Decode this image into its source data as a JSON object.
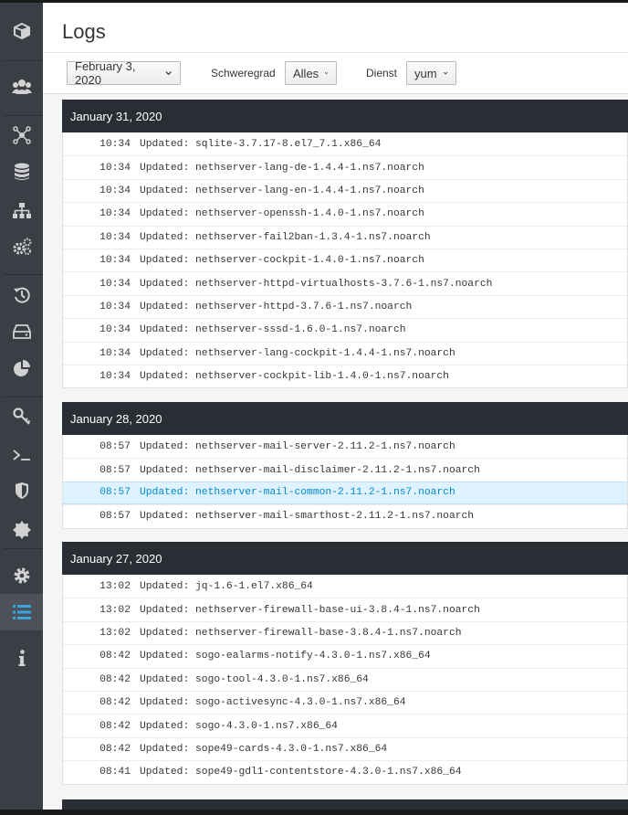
{
  "page": {
    "title": "Logs"
  },
  "filters": {
    "date_value": "February 3, 2020",
    "severity_label": "Schweregrad",
    "severity_value": "Alles",
    "service_label": "Dienst",
    "service_value": "yum"
  },
  "groups": [
    {
      "date": "January 31, 2020",
      "rows": [
        {
          "time": "10:34",
          "msg": "Updated: sqlite-3.7.17-8.el7_7.1.x86_64"
        },
        {
          "time": "10:34",
          "msg": "Updated: nethserver-lang-de-1.4.4-1.ns7.noarch"
        },
        {
          "time": "10:34",
          "msg": "Updated: nethserver-lang-en-1.4.4-1.ns7.noarch"
        },
        {
          "time": "10:34",
          "msg": "Updated: nethserver-openssh-1.4.0-1.ns7.noarch"
        },
        {
          "time": "10:34",
          "msg": "Updated: nethserver-fail2ban-1.3.4-1.ns7.noarch"
        },
        {
          "time": "10:34",
          "msg": "Updated: nethserver-cockpit-1.4.0-1.ns7.noarch"
        },
        {
          "time": "10:34",
          "msg": "Updated: nethserver-httpd-virtualhosts-3.7.6-1.ns7.noarch"
        },
        {
          "time": "10:34",
          "msg": "Updated: nethserver-httpd-3.7.6-1.ns7.noarch"
        },
        {
          "time": "10:34",
          "msg": "Updated: nethserver-sssd-1.6.0-1.ns7.noarch"
        },
        {
          "time": "10:34",
          "msg": "Updated: nethserver-lang-cockpit-1.4.4-1.ns7.noarch"
        },
        {
          "time": "10:34",
          "msg": "Updated: nethserver-cockpit-lib-1.4.0-1.ns7.noarch"
        }
      ]
    },
    {
      "date": "January 28, 2020",
      "rows": [
        {
          "time": "08:57",
          "msg": "Updated: nethserver-mail-server-2.11.2-1.ns7.noarch"
        },
        {
          "time": "08:57",
          "msg": "Updated: nethserver-mail-disclaimer-2.11.2-1.ns7.noarch"
        },
        {
          "time": "08:57",
          "msg": "Updated: nethserver-mail-common-2.11.2-1.ns7.noarch"
        },
        {
          "time": "08:57",
          "msg": "Updated: nethserver-mail-smarthost-2.11.2-1.ns7.noarch"
        }
      ]
    },
    {
      "date": "January 27, 2020",
      "rows": [
        {
          "time": "13:02",
          "msg": "Updated: jq-1.6-1.el7.x86_64"
        },
        {
          "time": "13:02",
          "msg": "Updated: nethserver-firewall-base-ui-3.8.4-1.ns7.noarch"
        },
        {
          "time": "13:02",
          "msg": "Updated: nethserver-firewall-base-3.8.4-1.ns7.noarch"
        },
        {
          "time": "08:42",
          "msg": "Updated: sogo-ealarms-notify-4.3.0-1.ns7.x86_64"
        },
        {
          "time": "08:42",
          "msg": "Updated: sogo-tool-4.3.0-1.ns7.x86_64"
        },
        {
          "time": "08:42",
          "msg": "Updated: sogo-activesync-4.3.0-1.ns7.x86_64"
        },
        {
          "time": "08:42",
          "msg": "Updated: sogo-4.3.0-1.ns7.x86_64"
        },
        {
          "time": "08:42",
          "msg": "Updated: sope49-cards-4.3.0-1.ns7.x86_64"
        },
        {
          "time": "08:41",
          "msg": "Updated: sope49-gdl1-contentstore-4.3.0-1.ns7.x86_64"
        }
      ]
    }
  ],
  "sidebar": {
    "items": [
      {
        "icon": "cube-icon"
      },
      {
        "icon": "users-icon"
      },
      {
        "icon": "network-icon"
      },
      {
        "icon": "database-icon"
      },
      {
        "icon": "sitemap-icon"
      },
      {
        "icon": "cogs-icon"
      },
      {
        "icon": "history-icon"
      },
      {
        "icon": "storage-icon"
      },
      {
        "icon": "pie-chart-icon"
      },
      {
        "icon": "key-icon"
      },
      {
        "icon": "terminal-icon"
      },
      {
        "icon": "shield-icon"
      },
      {
        "icon": "badge-icon"
      },
      {
        "icon": "gear-icon"
      },
      {
        "icon": "list-icon",
        "active": true
      },
      {
        "icon": "info-icon"
      }
    ]
  },
  "colors": {
    "sidebar_bg": "#393f44",
    "group_header_bg": "#292e34",
    "highlight_row": "#def3ff",
    "highlight_text": "#0088ce"
  }
}
